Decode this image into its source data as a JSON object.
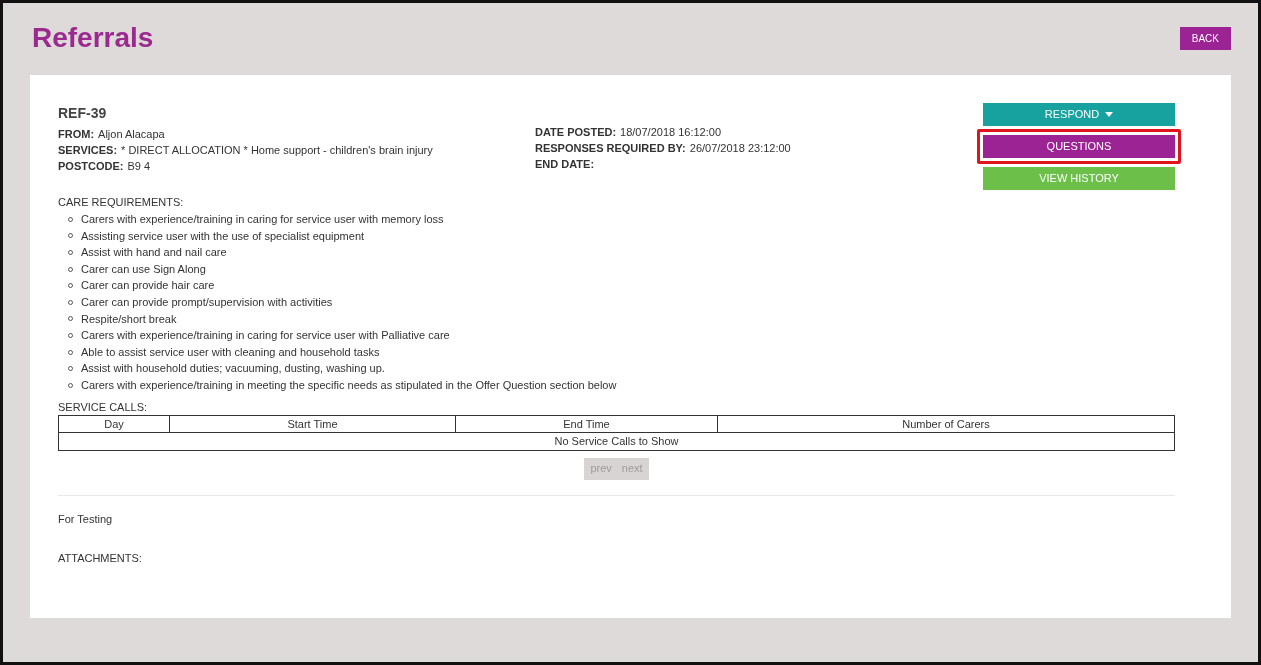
{
  "page": {
    "title": "Referrals",
    "back_button": "BACK"
  },
  "referral": {
    "reference": "REF-39",
    "left_fields": [
      {
        "label": "FROM:",
        "value": "Aljon Alacapa"
      },
      {
        "label": "SERVICES:",
        "value": "* DIRECT ALLOCATION * Home support - children's brain injury"
      },
      {
        "label": "POSTCODE:",
        "value": "B9 4"
      }
    ],
    "right_fields": [
      {
        "label": "DATE POSTED:",
        "value": "18/07/2018 16:12:00"
      },
      {
        "label": "RESPONSES REQUIRED BY:",
        "value": "26/07/2018 23:12:00"
      },
      {
        "label": "END DATE:"
      }
    ]
  },
  "actions": [
    {
      "label": "RESPOND",
      "kind": "dropdown",
      "color": "#17a2a0",
      "highlighted": false
    },
    {
      "label": "QUESTIONS",
      "kind": "plain",
      "color": "#9b2394",
      "highlighted": true
    },
    {
      "label": "VIEW HISTORY",
      "kind": "plain",
      "color": "#6cc04a",
      "highlighted": false
    }
  ],
  "care_requirements": {
    "heading": "CARE REQUIREMENTS:",
    "items": [
      "Carers with experience/training in caring for service user with memory loss",
      "Assisting service user with the use of specialist equipment",
      "Assist with hand and nail care",
      "Carer can use Sign Along",
      "Carer can provide hair care",
      "Carer can provide prompt/supervision with activities",
      "Respite/short break",
      "Carers with experience/training in caring for service user with Palliative care",
      "Able to assist service user with cleaning and household tasks",
      "Assist with household duties; vacuuming, dusting, washing up.",
      "Carers with experience/training in meeting the specific needs as stipulated in the Offer Question section below"
    ]
  },
  "service_calls": {
    "heading": "SERVICE CALLS:",
    "columns": [
      "Day",
      "Start Time",
      "End Time",
      "Number of Carers"
    ],
    "empty_message": "No Service Calls to Show",
    "pagination": [
      {
        "label": "prev",
        "disabled": true
      },
      {
        "label": "next",
        "disabled": true
      }
    ]
  },
  "notes": "For Testing",
  "attachments": {
    "heading": "ATTACHMENTS:"
  }
}
